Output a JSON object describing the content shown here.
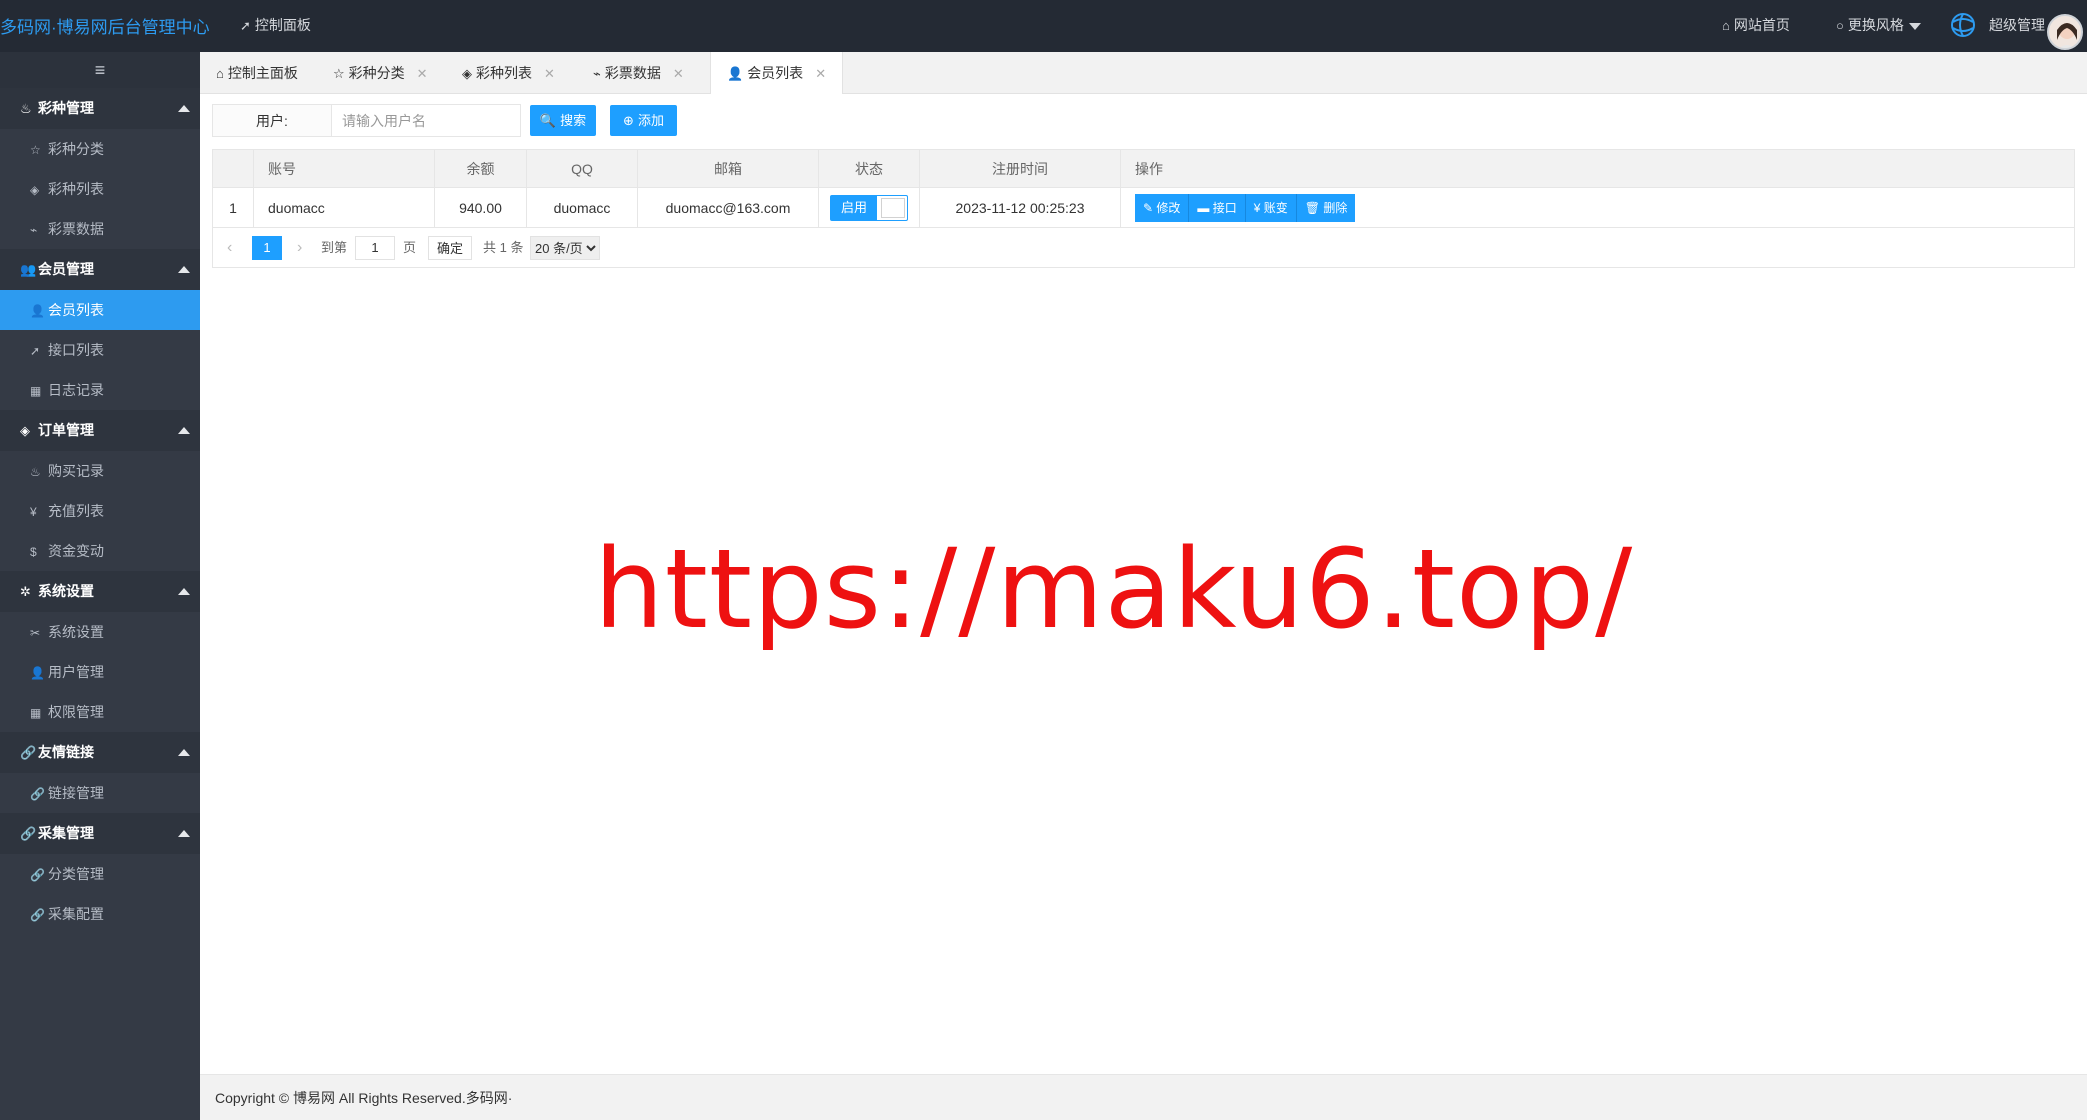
{
  "header": {
    "brand": "多码网·博易网后台管理中心",
    "dashboard": "控制面板",
    "site_home": "网站首页",
    "change_style": "更换风格",
    "user_name": "超级管理",
    "icons": {
      "dashboard": "send-icon",
      "home": "home-icon",
      "style": "circle-icon",
      "globe": "globe-logo-icon"
    }
  },
  "sidebar": {
    "toggle_icon": "≡",
    "groups": [
      {
        "label": "彩种管理",
        "items": [
          "彩种分类",
          "彩种列表",
          "彩票数据"
        ]
      },
      {
        "label": "会员管理",
        "items": [
          "会员列表",
          "接口列表",
          "日志记录"
        ]
      },
      {
        "label": "订单管理",
        "items": [
          "购买记录",
          "充值列表",
          "资金变动"
        ]
      },
      {
        "label": "系统设置",
        "items": [
          "系统设置",
          "用户管理",
          "权限管理"
        ]
      },
      {
        "label": "友情链接",
        "items": [
          "链接管理"
        ]
      },
      {
        "label": "采集管理",
        "items": [
          "分类管理",
          "采集配置"
        ]
      }
    ],
    "active_item": "会员列表"
  },
  "tabs": [
    {
      "label": "控制主面板"
    },
    {
      "label": "彩种分类"
    },
    {
      "label": "彩种列表"
    },
    {
      "label": "彩票数据"
    },
    {
      "label": "会员列表"
    }
  ],
  "search": {
    "label": "用户:",
    "placeholder": "请输入用户名",
    "search_button": "搜索",
    "add_button": "添加"
  },
  "table": {
    "columns": [
      "",
      "账号",
      "余额",
      "QQ",
      "邮箱",
      "状态",
      "注册时间",
      "操作"
    ],
    "rows": [
      {
        "index": "1",
        "account": "duomacc",
        "balance": "940.00",
        "qq": "duomacc",
        "email": "duomacc@163.com",
        "status": "启用",
        "registered": "2023-11-12 00:25:23"
      }
    ],
    "actions": [
      "修改",
      "接口",
      "账变",
      "删除"
    ]
  },
  "pager": {
    "current": "1",
    "goto_label": "到第",
    "goto_value": "1",
    "page_unit": "页",
    "confirm": "确定",
    "total": "共 1 条",
    "per_page": "20 条/页"
  },
  "watermark": "https://maku6.top/",
  "footer": "Copyright © 博易网 All Rights Reserved.多码网·",
  "colors": {
    "accent": "#1e9fff",
    "sidebar": "#343a45",
    "topbar": "#242a34",
    "watermark": "#ee1111"
  }
}
